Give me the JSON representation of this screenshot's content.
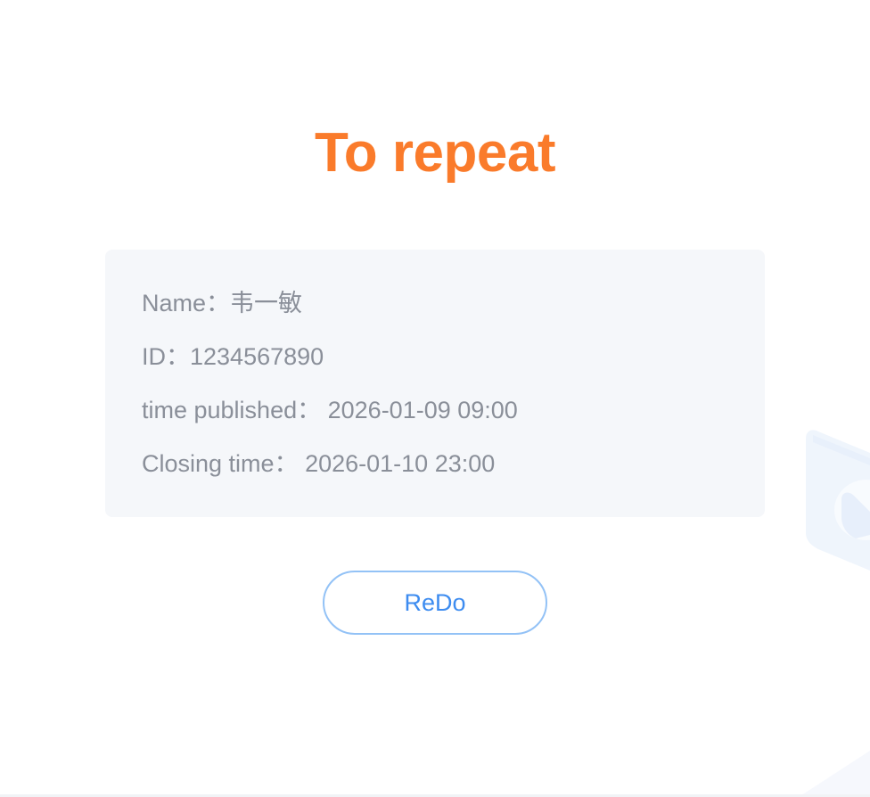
{
  "title": "To repeat",
  "info": {
    "name_label": "Name：",
    "name_value": "韦一敏",
    "id_label": "ID：",
    "id_value": "1234567890",
    "published_label": "time published：",
    "published_value": "2026-01-09 09:00",
    "closing_label": "Closing time：",
    "closing_value": "2026-01-10 23:00"
  },
  "actions": {
    "redo_label": "ReDo"
  },
  "colors": {
    "title": "#fa7b2b",
    "card_background": "#f5f7fa",
    "info_text": "#8a8f99",
    "button_border": "#93c2f6",
    "button_text": "#3d8cf0"
  },
  "decoration": {
    "icon": "document-play-icon"
  }
}
